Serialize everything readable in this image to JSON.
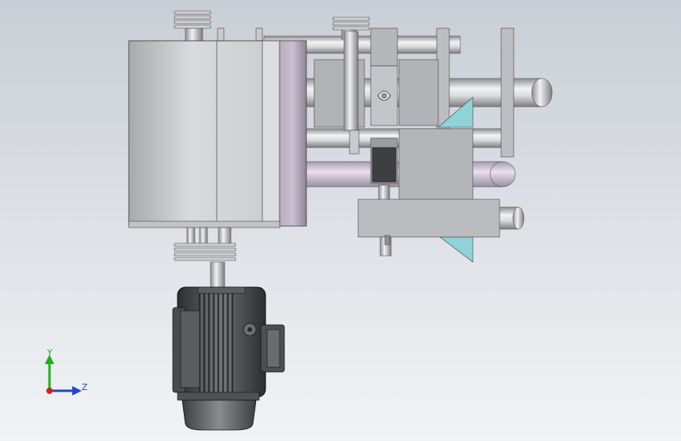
{
  "viewport": {
    "background_top": "#c9ced6",
    "background_bottom": "#f2f3f5"
  },
  "triad": {
    "y_label": "Y",
    "z_label": "Z",
    "y_color": "#22aa22",
    "z_color": "#2244cc",
    "x_color": "#cc2222"
  },
  "colors": {
    "metal_light": "#d8d9dc",
    "metal_mid": "#a8aaad",
    "metal_dark": "#4a4b4e",
    "teal": "#8fd3d6",
    "motor_dark": "#3a3b3d",
    "accent_purple": "#9a8fa3"
  }
}
